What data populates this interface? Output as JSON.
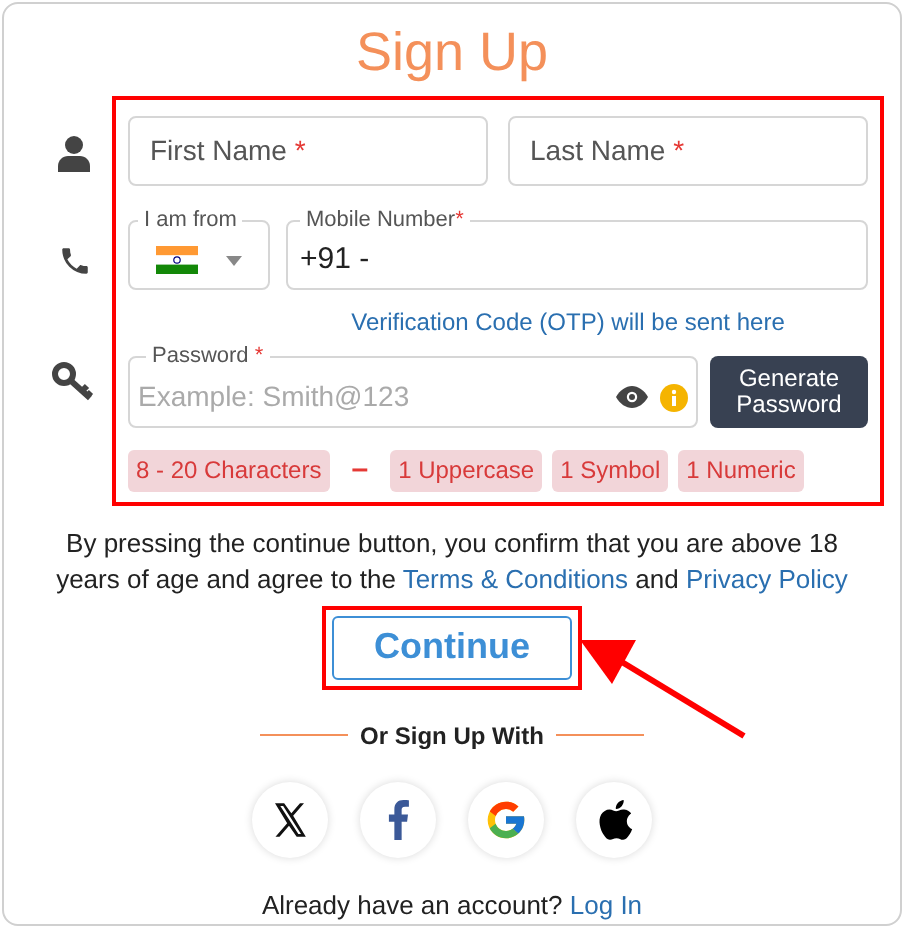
{
  "title": "Sign Up",
  "name_fields": [
    {
      "placeholder": "First Name",
      "mark": "*"
    },
    {
      "placeholder": "Last Name",
      "mark": "*"
    }
  ],
  "country": {
    "label": "I am from"
  },
  "mobile": {
    "label": "Mobile Number",
    "mark": "*",
    "value": "+91 -"
  },
  "otp_note": "Verification Code (OTP) will be sent here",
  "password": {
    "label": "Password",
    "mark": "*",
    "placeholder": "Example: Smith@123"
  },
  "generate_button": "Generate Password",
  "requirements": [
    {
      "kind": "chip",
      "text": "8 - 20 Characters"
    },
    {
      "kind": "separator",
      "text": "–"
    },
    {
      "kind": "chip",
      "text": "1 Uppercase"
    },
    {
      "kind": "chip",
      "text": "1 Symbol"
    },
    {
      "kind": "chip",
      "text": "1 Numeric"
    }
  ],
  "consent": {
    "text": "By pressing the continue button, you confirm that you are above 18 years of age and agree to the",
    "terms": "Terms & Conditions",
    "joiner": "and",
    "privacy": "Privacy Policy"
  },
  "continue_button": "Continue",
  "divider": "Or Sign Up With",
  "socials": [
    {
      "kind": "x"
    },
    {
      "kind": "facebook"
    },
    {
      "kind": "google"
    },
    {
      "kind": "apple"
    }
  ],
  "footer": {
    "text": "Already have an account?",
    "link": "Log In"
  }
}
